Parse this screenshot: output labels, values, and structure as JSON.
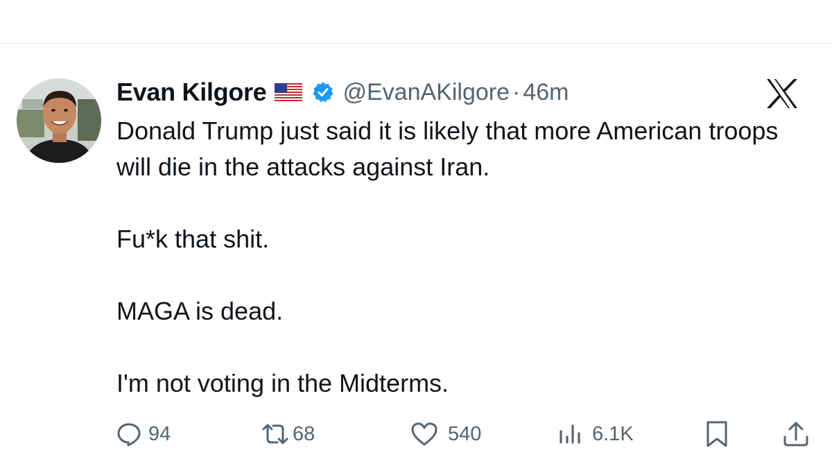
{
  "tweet": {
    "display_name": "Evan Kilgore",
    "flag_emoji": "🇺🇸",
    "handle": "@EvanAKilgore",
    "separator": "·",
    "time": "46m",
    "paragraphs": [
      "Donald Trump just said it is likely that more American troops will die in the attacks against Iran.",
      "Fu*k that shit.",
      "MAGA is dead.",
      "I'm not voting in the Midterms."
    ],
    "actions": {
      "reply_count": "94",
      "repost_count": "68",
      "like_count": "540",
      "views_count": "6.1K"
    }
  },
  "icons": {
    "reply": "speech-bubble-icon",
    "repost": "repost-arrows-icon",
    "like": "heart-icon",
    "views": "bar-chart-icon",
    "bookmark": "bookmark-icon",
    "share": "share-upload-icon",
    "platform_logo": "x-logo-icon",
    "verified": "verified-badge-icon"
  },
  "colors": {
    "text_primary": "#0f1419",
    "text_secondary": "#536471",
    "verified_blue": "#1d9bf0",
    "divider": "#e6e9ec"
  }
}
